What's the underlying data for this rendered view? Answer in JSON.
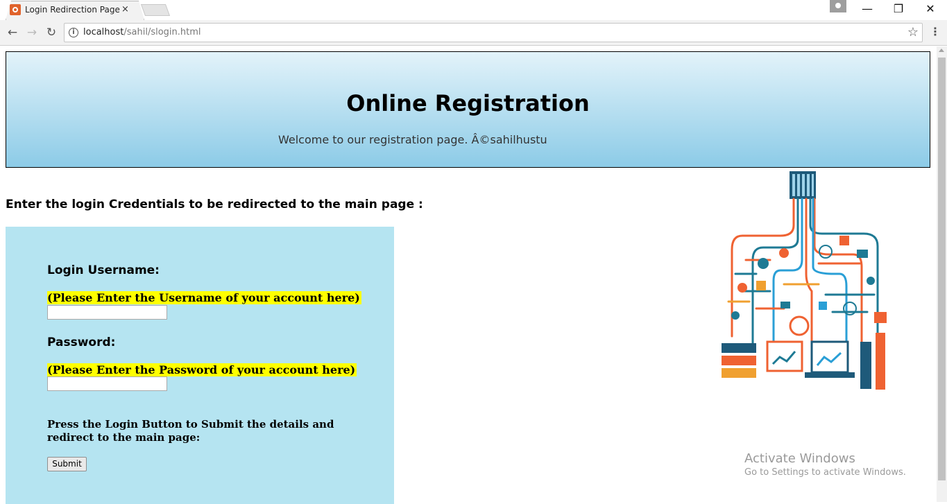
{
  "browser": {
    "tab_title": "Login Redirection Page",
    "tab_close": "×",
    "url_host": "localhost",
    "url_path": "/sahil/slogin.html",
    "controls": {
      "minimize": "—",
      "restore": "❐",
      "close": "✕"
    },
    "nav": {
      "back": "←",
      "forward": "→",
      "reload": "↻"
    },
    "star": "☆",
    "menu": "⋮",
    "info": "i"
  },
  "page": {
    "header_title": "Online Registration",
    "header_subtitle": "Welcome to our registration page. Â©sahilhustu",
    "instruction": "Enter the login Credentials to be redirected to the main page :",
    "form": {
      "username_label": "Login Username:",
      "username_hint": "(Please Enter the Username of your account here)",
      "username_value": "",
      "password_label": "Password:",
      "password_hint": "(Please Enter the Password of your account here)",
      "password_value": "",
      "press_text": "Press the Login Button to Submit the details and redirect to the main page:",
      "submit_label": "Submit"
    }
  },
  "watermark": {
    "line1": "Activate Windows",
    "line2": "Go to Settings to activate Windows."
  },
  "colors": {
    "header_gradient_top": "#e3f3fa",
    "header_gradient_bottom": "#8ccbe7",
    "form_background": "#b5e4f1",
    "hint_highlight": "#ffff00",
    "illustration_orange": "#ef6232",
    "illustration_teal": "#1e7a94",
    "illustration_blue": "#2a9fd6"
  }
}
